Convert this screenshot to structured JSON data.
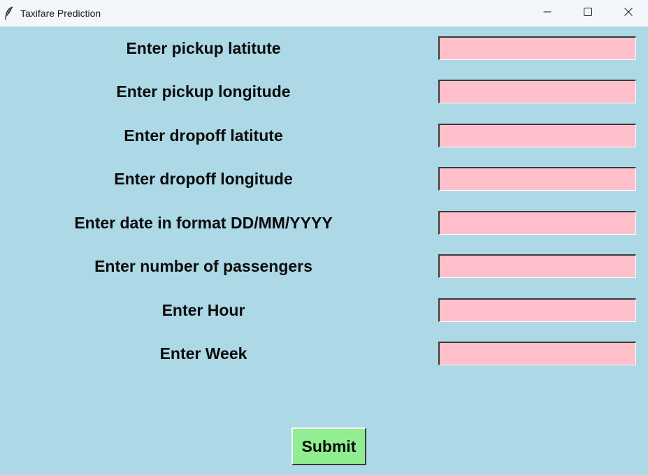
{
  "window": {
    "title": "Taxifare Prediction",
    "icon": "feather-icon"
  },
  "colors": {
    "background": "#add8e6",
    "entry_background": "#ffc0cb",
    "button_background": "#90ee90",
    "titlebar": "#f3f6fb"
  },
  "form": {
    "fields": [
      {
        "label": "Enter pickup latitute",
        "value": ""
      },
      {
        "label": "Enter pickup longitude",
        "value": ""
      },
      {
        "label": "Enter dropoff latitute",
        "value": ""
      },
      {
        "label": "Enter dropoff longitude",
        "value": ""
      },
      {
        "label": "Enter date in format DD/MM/YYYY",
        "value": ""
      },
      {
        "label": "Enter number of passengers",
        "value": ""
      },
      {
        "label": "Enter Hour",
        "value": ""
      },
      {
        "label": "Enter Week",
        "value": ""
      }
    ],
    "submit_label": "Submit"
  }
}
